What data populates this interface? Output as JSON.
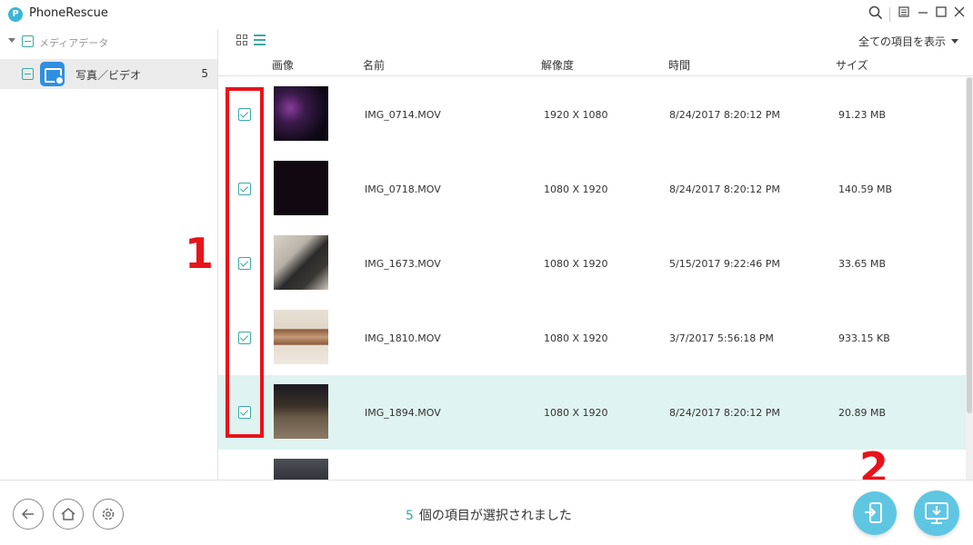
{
  "app": {
    "title": "PhoneRescue",
    "logo_letter": "P"
  },
  "titlebar": {
    "search_icon": "search-icon",
    "menu_icon": "menu-icon",
    "minimize_icon": "minimize-icon",
    "maximize_icon": "maximize-icon",
    "close_icon": "close-icon"
  },
  "sidebar": {
    "root_label": "メディアデータ",
    "items": [
      {
        "label": "写真／ビデオ",
        "count": "5",
        "icon": "photo-video-icon"
      }
    ]
  },
  "toolbar": {
    "filter_label": "全ての項目を表示"
  },
  "table": {
    "columns": [
      "画像",
      "名前",
      "解像度",
      "時間",
      "サイズ"
    ],
    "rows": [
      {
        "name": "IMG_0714.MOV",
        "resolution": "1920 X 1080",
        "time": "8/24/2017 8:20:12 PM",
        "size": "91.23 MB",
        "checked": true,
        "selected": false,
        "thumb": "#3a2a4a"
      },
      {
        "name": "IMG_0718.MOV",
        "resolution": "1080 X 1920",
        "time": "8/24/2017 8:20:12 PM",
        "size": "140.59 MB",
        "checked": true,
        "selected": false,
        "thumb": "#120812"
      },
      {
        "name": "IMG_1673.MOV",
        "resolution": "1080 X 1920",
        "time": "5/15/2017 9:22:46 PM",
        "size": "33.65 MB",
        "checked": true,
        "selected": false,
        "thumb": "#b8b2a8"
      },
      {
        "name": "IMG_1810.MOV",
        "resolution": "1080 X 1920",
        "time": "3/7/2017 5:56:18 PM",
        "size": "933.15 KB",
        "checked": true,
        "selected": false,
        "thumb": "#c6a888"
      },
      {
        "name": "IMG_1894.MOV",
        "resolution": "1080 X 1920",
        "time": "8/24/2017 8:20:12 PM",
        "size": "20.89 MB",
        "checked": true,
        "selected": true,
        "thumb": "#5a5040"
      }
    ]
  },
  "annotations": {
    "one": "1",
    "two": "2"
  },
  "footer": {
    "selected_count": "5",
    "status_text": "個の項目が選択されました",
    "back_icon": "back-arrow-icon",
    "home_icon": "home-icon",
    "settings_icon": "gear-icon",
    "to_device_icon": "to-device-icon",
    "to_computer_icon": "to-computer-icon"
  },
  "colors": {
    "accent": "#3aa99f",
    "selected_row": "#dff3f0",
    "action_button": "#5fc6e2",
    "annotation": "#e8131b"
  }
}
